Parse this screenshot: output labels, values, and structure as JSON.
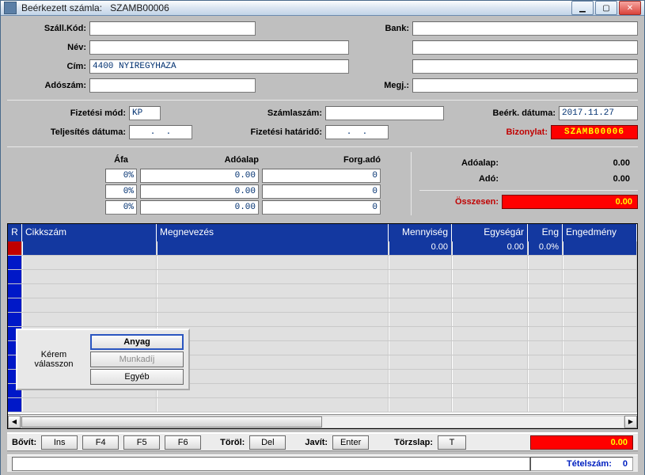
{
  "window": {
    "title_prefix": "Beérkezett számla:",
    "title_id": "SZAMB00006"
  },
  "labels": {
    "szall_kod": "Száll.Kód:",
    "nev": "Név:",
    "cim": "Cím:",
    "adoszam": "Adószám:",
    "bank": "Bank:",
    "megj": "Megj.:",
    "fizmod": "Fizetési mód:",
    "telj_datum": "Teljesítés dátuma:",
    "szamlaszam": "Számlaszám:",
    "fiz_hatarido": "Fizetési határidő:",
    "beerk_datuma": "Beérk. dátuma:",
    "bizonylat": "Bizonylat:",
    "afa": "Áfa",
    "adoalap": "Adóalap",
    "forgado": "Forg.adó",
    "sum_adoalap": "Adóalap:",
    "sum_ado": "Adó:",
    "osszesen": "Összesen:"
  },
  "fields": {
    "szall_kod": "",
    "nev": "",
    "cim": "4400 NYIREGYHAZA",
    "adoszam": "",
    "bank1": "",
    "bank2": "",
    "bank3": "",
    "megj": "",
    "fizmod": "KP",
    "telj_datum": "  .  .  ",
    "szamlaszam": "",
    "fiz_hatarido": "  .  .  ",
    "beerk_datuma": "2017.11.27",
    "bizonylat": "SZAMB00006"
  },
  "afa_rows": [
    {
      "pct": "0%",
      "adoalap": "0.00",
      "forgado": "0"
    },
    {
      "pct": "0%",
      "adoalap": "0.00",
      "forgado": "0"
    },
    {
      "pct": "0%",
      "adoalap": "0.00",
      "forgado": "0"
    }
  ],
  "totals": {
    "adoalap": "0.00",
    "ado": "0.00",
    "osszesen": "0.00"
  },
  "grid": {
    "headers": {
      "r": "R",
      "cikkszam": "Cikkszám",
      "megnevezes": "Megnevezés",
      "mennyiseg": "Mennyiség",
      "egysegar": "Egységár",
      "eng": "Eng",
      "engedmeny": "Engedmény"
    },
    "selected_row": {
      "cikkszam": "",
      "megnevezes": "",
      "mennyiseg": "0.00",
      "egysegar": "0.00",
      "eng": "0.0%",
      "engedmeny": ""
    }
  },
  "popup": {
    "label_line1": "Kérem",
    "label_line2": "válasszon",
    "btn_anyag": "Anyag",
    "btn_munkadij": "Munkadíj",
    "btn_egyeb": "Egyéb"
  },
  "fnbar": {
    "bovit": "Bővít:",
    "ins": "Ins",
    "f4": "F4",
    "f5": "F5",
    "f6": "F6",
    "torol": "Töröl:",
    "del": "Del",
    "javit": "Javít:",
    "enter": "Enter",
    "torzslap": "Törzslap:",
    "t": "T",
    "total": "0.00"
  },
  "status": {
    "tetelszam_label": "Tételszám:",
    "tetelszam_value": "0"
  }
}
